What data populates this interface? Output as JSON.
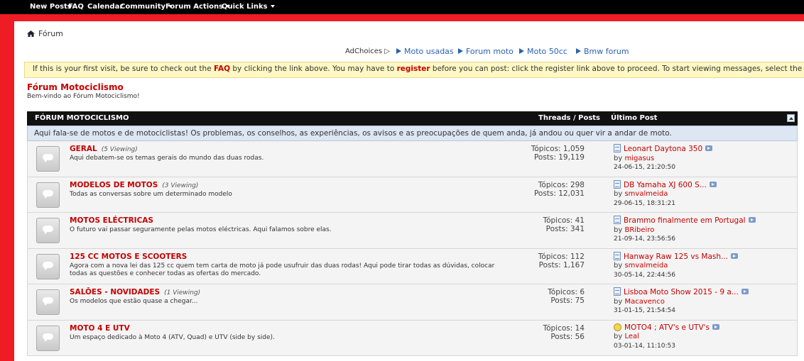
{
  "nav": {
    "items": [
      {
        "label": "New Posts",
        "dropdown": false
      },
      {
        "label": "FAQ",
        "dropdown": false
      },
      {
        "label": "Calendar",
        "dropdown": false
      },
      {
        "label": "Community",
        "dropdown": true
      },
      {
        "label": "Forum Actions",
        "dropdown": true
      },
      {
        "label": "Quick Links",
        "dropdown": true
      }
    ]
  },
  "breadcrumb": {
    "label": "Fórum"
  },
  "ads": {
    "adchoices": "AdChoices ▷",
    "links": [
      "Moto usadas",
      "Forum moto",
      "Moto 50cc",
      "Bmw forum"
    ]
  },
  "notice": {
    "p1": "If this is your first visit, be sure to check out the ",
    "faq": "FAQ",
    "p2": " by clicking the link above. You may have to ",
    "register": "register",
    "p3": " before you can post: click the register link above to proceed. To start viewing messages, select the forum that you want to visit from the selection below."
  },
  "forum": {
    "title": "Fórum Motociclismo",
    "subtitle": "Bem-vindo ao Fórum Motociclismo!"
  },
  "category": {
    "title": "FÓRUM MOTOCICLISMO",
    "threads_posts": "Threads / Posts",
    "last_post": "Último Post",
    "description": "Aqui fala-se de motos e de motociclistas! Os problemas, os conselhos, as experiências, os avisos e as preocupações de quem anda, já andou ou quer vir a andar de moto."
  },
  "forums": [
    {
      "name": "GERAL",
      "viewing": "(5 Viewing)",
      "desc": "Aqui debatem-se os temas gerais do mundo das duas rodas.",
      "topics": "Tópicos: 1,059",
      "posts": "Posts: 19,119",
      "last_title": "Leonart Daytona 350",
      "last_by": "by",
      "last_user": "migasus",
      "last_date": "24-06-15, 21:20:50",
      "last_icon": "document-icon"
    },
    {
      "name": "MODELOS DE MOTOS",
      "viewing": "(3 Viewing)",
      "desc": "Todas as conversas sobre um determinado modelo",
      "topics": "Tópicos: 298",
      "posts": "Posts: 12,031",
      "last_title": "DB Yamaha XJ 600 S...",
      "last_by": "by",
      "last_user": "smvalmeida",
      "last_date": "29-06-15, 18:31:21",
      "last_icon": "document-icon"
    },
    {
      "name": "MOTOS ELÉCTRICAS",
      "viewing": "",
      "desc": "O futuro vai passar seguramente pelas motos eléctricas. Aqui falamos sobre elas.",
      "topics": "Tópicos: 41",
      "posts": "Posts: 341",
      "last_title": "Brammo finalmente em Portugal",
      "last_by": "by",
      "last_user": "BRibeiro",
      "last_date": "21-09-14, 23:56:56",
      "last_icon": "document-icon"
    },
    {
      "name": "125 CC MOTOS E SCOOTERS",
      "viewing": "",
      "desc": "Agora com a nova lei das 125 cc quem tem carta de moto já pode usufruir das duas rodas! Aqui pode tirar todas as dúvidas, colocar todas as questões e conhecer todas as ofertas do mercado.",
      "topics": "Tópicos: 112",
      "posts": "Posts: 1,167",
      "last_title": "Hanway Raw 125 vs Mash...",
      "last_by": "by",
      "last_user": "smvalmeida",
      "last_date": "30-05-14, 22:44:56",
      "last_icon": "document-icon"
    },
    {
      "name": "SALÕES - NOVIDADES",
      "viewing": "(1 Viewing)",
      "desc": "Os modelos que estão quase a chegar...",
      "topics": "Tópicos: 6",
      "posts": "Posts: 75",
      "last_title": "Lisboa Moto Show 2015 - 9 a...",
      "last_by": "by",
      "last_user": "Macavenco",
      "last_date": "31-01-15, 21:54:54",
      "last_icon": "document-icon"
    },
    {
      "name": "MOTO 4 E UTV",
      "viewing": "",
      "desc": "Um espaço dedicado à Moto 4 (ATV, Quad) e UTV (side by side).",
      "topics": "Tópicos: 14",
      "posts": "Posts: 56",
      "last_title": "MOTO4 ; ATV's e UTV's",
      "last_by": "by",
      "last_user": "Leal",
      "last_date": "03-01-14, 11:10:53",
      "last_icon": "smile-icon"
    }
  ]
}
